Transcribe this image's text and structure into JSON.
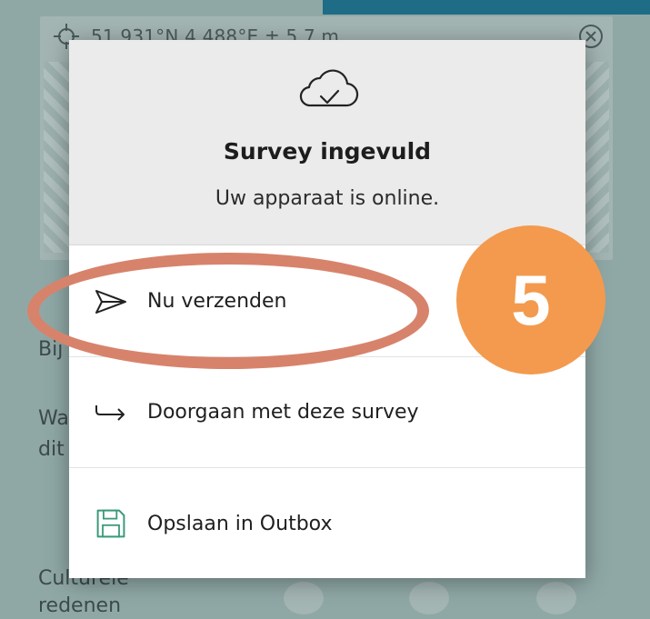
{
  "background": {
    "coordinates": "51.931°N 4.488°E ± 5.7 m",
    "labels": {
      "bij": "Bij",
      "wa": "Wa",
      "dit": "dit",
      "culturele": "Culturele",
      "redenen": "redenen"
    }
  },
  "dialog": {
    "icon": "cloud-check-icon",
    "title": "Survey ingevuld",
    "subtitle": "Uw apparaat is online.",
    "options": [
      {
        "icon": "send-icon",
        "label": "Nu verzenden"
      },
      {
        "icon": "arrow-return-icon",
        "label": "Doorgaan met deze survey"
      },
      {
        "icon": "save-disk-icon",
        "label": "Opslaan in Outbox"
      }
    ]
  },
  "annotation": {
    "step_number": "5",
    "badge_color": "#f39a4e",
    "ring_color": "#d7836b"
  },
  "colors": {
    "top_bar": "#1f6c86",
    "save_icon": "#3a9a7a"
  }
}
